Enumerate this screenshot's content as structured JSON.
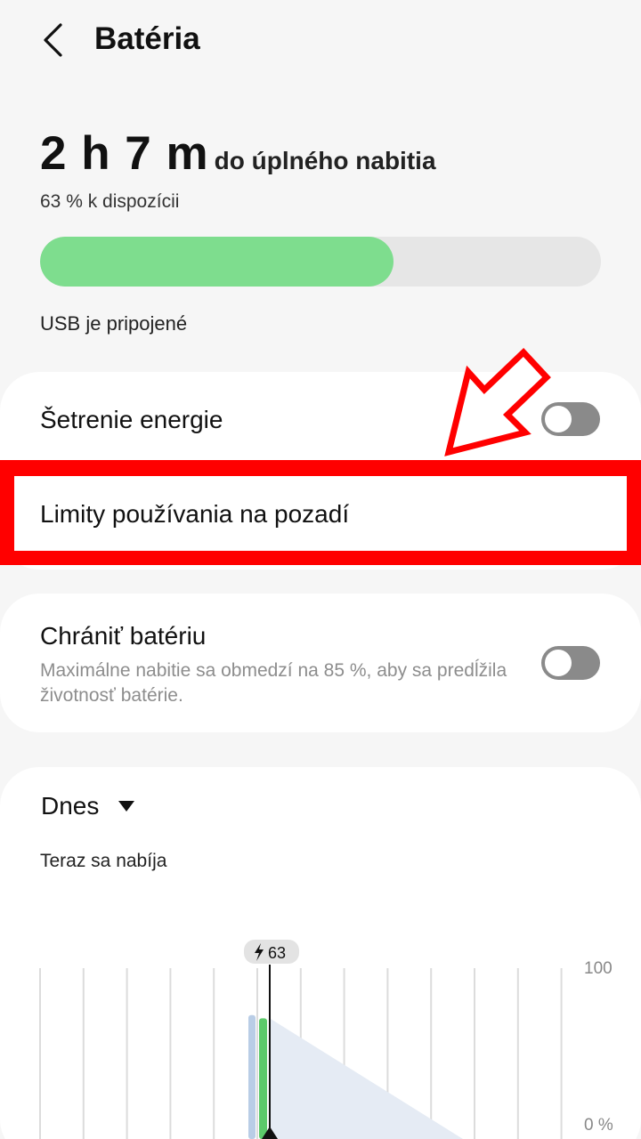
{
  "header": {
    "title": "Batéria",
    "back_icon": "chevron-left-icon"
  },
  "summary": {
    "time_remaining": "2 h 7 m",
    "suffix": "do úplného nabitia",
    "available": "63 % k dispozícii",
    "charge_level": 63,
    "bar_color": "#7edd8e",
    "usb_status": "USB je pripojené"
  },
  "settings": {
    "power_saving": {
      "label": "Šetrenie energie",
      "enabled": false
    },
    "background_limits": {
      "label": "Limity používania na pozadí"
    },
    "protect_battery": {
      "label": "Chrániť batériu",
      "description": "Maximálne nabitie sa obmedzí na 85 %, aby sa predĺžila životnosť batérie.",
      "enabled": false
    }
  },
  "usage": {
    "period_label": "Dnes",
    "status_text": "Teraz sa nabíja"
  },
  "annotation": {
    "highlight_color": "#ff0000"
  },
  "chart_data": {
    "type": "area",
    "y_ticks": [
      "100",
      "0 %"
    ],
    "ylim": [
      0,
      100
    ],
    "current_marker": {
      "label": "63",
      "icon": "bolt-icon",
      "value": 63
    },
    "history_bar": {
      "value": 70,
      "color": "#b9cde6"
    },
    "current_bar": {
      "value": 68,
      "color": "#5cc96a"
    },
    "projection": {
      "start": 68,
      "end": 0,
      "color": "#e5ebf4"
    },
    "grid": true
  }
}
